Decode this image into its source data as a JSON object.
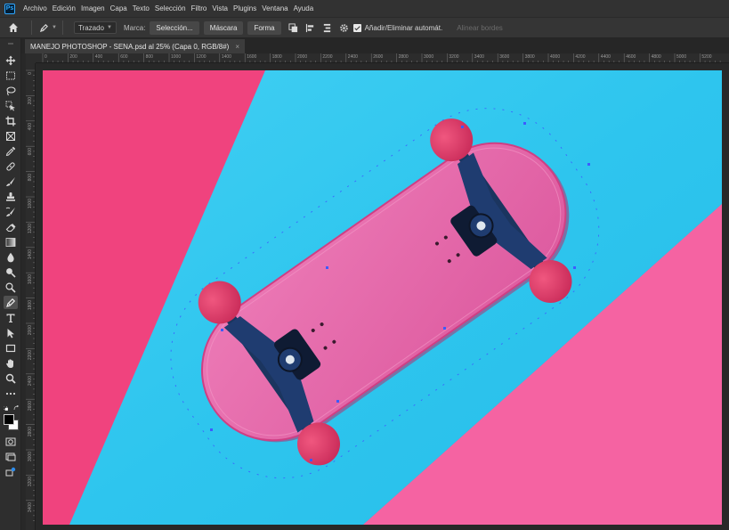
{
  "app": {
    "logo": "Ps"
  },
  "menu": [
    "Archivo",
    "Edición",
    "Imagen",
    "Capa",
    "Texto",
    "Selección",
    "Filtro",
    "Vista",
    "Plugins",
    "Ventana",
    "Ayuda"
  ],
  "options": {
    "mode": "Trazado",
    "marca_label": "Marca:",
    "buttons": [
      "Selección...",
      "Máscara",
      "Forma"
    ],
    "auto_add_label": "Añadir/Eliminar automát.",
    "auto_add_checked": true,
    "align_edges": "Alinear bordes"
  },
  "document": {
    "tab_title": "MANEJO PHOTOSHOP - SENA.psd al 25% (Capa 0, RGB/8#)",
    "close_symbol": "×"
  },
  "ruler": {
    "horizontal": [
      "0",
      "200",
      "400",
      "600",
      "800",
      "1000",
      "1200",
      "1400",
      "1600",
      "1800",
      "2000",
      "2200",
      "2400",
      "2600",
      "2800",
      "3000",
      "3200",
      "3400",
      "3600",
      "3800",
      "4000",
      "4200",
      "4400",
      "4600",
      "4800",
      "5000",
      "5200"
    ],
    "vertical": [
      "0",
      "200",
      "400",
      "600",
      "800",
      "1000",
      "1200",
      "1400",
      "1600",
      "1800",
      "2000",
      "2200",
      "2400",
      "2600",
      "2800",
      "3000",
      "3200",
      "3400"
    ]
  },
  "tools": [
    "move-tool",
    "marquee-tool",
    "lasso-tool",
    "object-select-tool",
    "crop-tool",
    "frame-tool",
    "eyedropper-tool",
    "healing-brush-tool",
    "brush-tool",
    "clone-stamp-tool",
    "history-brush-tool",
    "eraser-tool",
    "gradient-tool",
    "blur-tool",
    "dodge-tool",
    "burn-tool",
    "pen-tool",
    "type-tool",
    "path-selection-tool",
    "rectangle-tool",
    "hand-tool",
    "zoom-tool",
    "more-tools"
  ],
  "active_tool": "pen-tool",
  "colors": {
    "foreground": "#000000",
    "background": "#ffffff",
    "image_pink": "#f0437e",
    "image_pink_light": "#f563a2",
    "image_cyan": "#2ec5ee",
    "deck_pink": "#e665a9",
    "wheel_pink": "#e33d6c",
    "truck_navy": "#1f3c70",
    "path_blue": "#3d5bff"
  }
}
